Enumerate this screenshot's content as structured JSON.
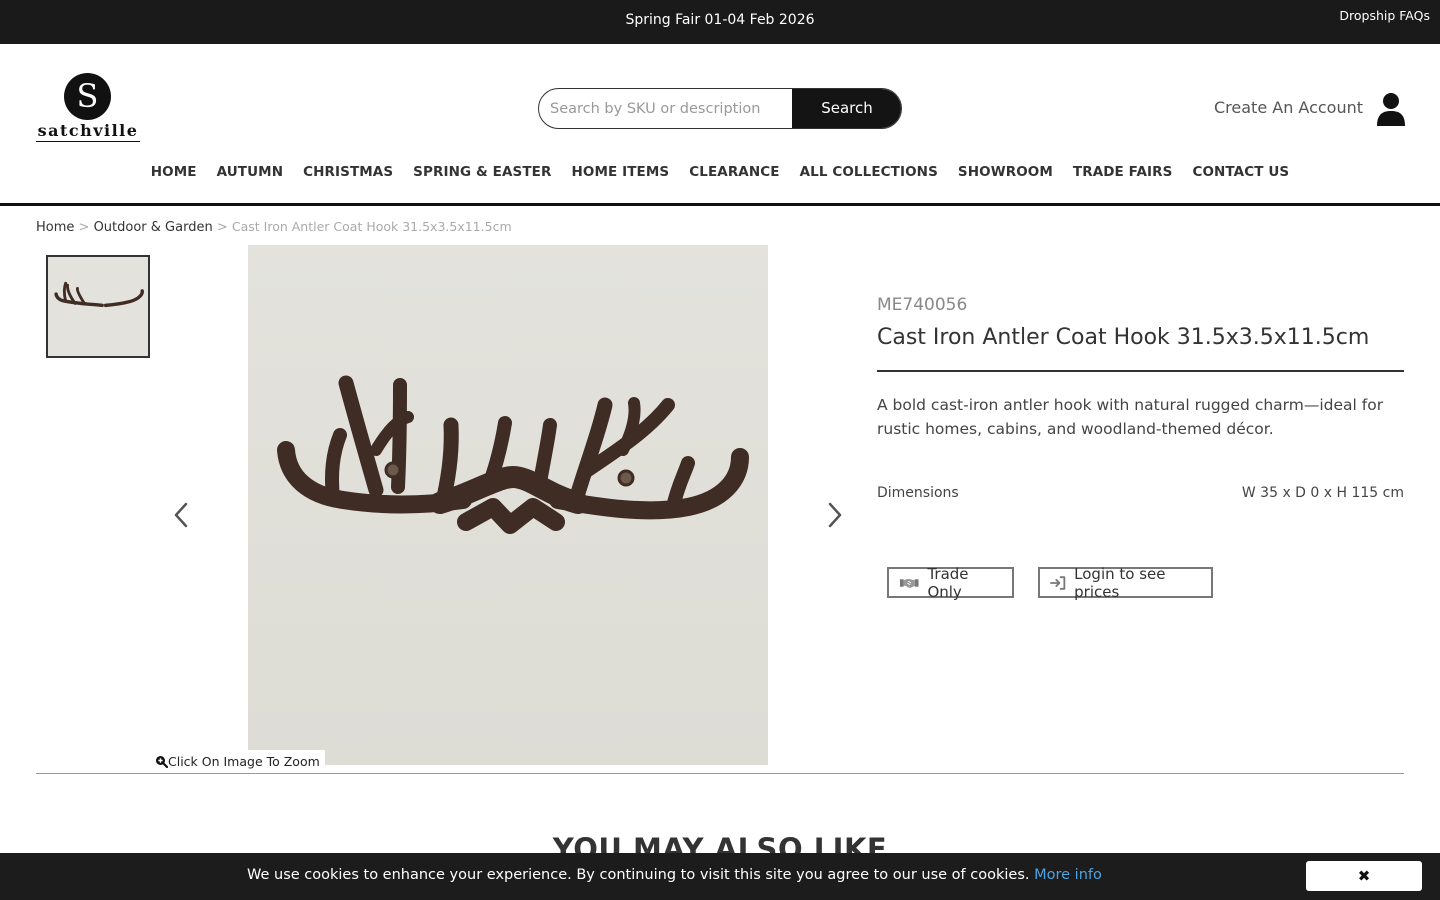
{
  "topbar": {
    "announcement": "Spring Fair 01-04 Feb 2026",
    "dropship_link": "Dropship FAQs"
  },
  "header": {
    "logo_letter": "S",
    "logo_word": "satchville",
    "search_placeholder": "Search by SKU or description",
    "search_button": "Search",
    "create_account": "Create An Account",
    "user_icon": "user-icon"
  },
  "nav": {
    "items": [
      "HOME",
      "AUTUMN",
      "CHRISTMAS",
      "SPRING & EASTER",
      "HOME ITEMS",
      "CLEARANCE",
      "ALL COLLECTIONS",
      "SHOWROOM",
      "TRADE FAIRS",
      "CONTACT US"
    ]
  },
  "breadcrumb": {
    "home": "Home",
    "separator": ">",
    "category": "Outdoor & Garden",
    "current": "Cast Iron Antler Coat Hook 31.5x3.5x11.5cm"
  },
  "gallery": {
    "zoom_note": "Click On Image To Zoom",
    "prev_icon": "chevron-left-icon",
    "next_icon": "chevron-right-icon"
  },
  "product": {
    "sku": "ME740056",
    "title": "Cast Iron Antler Coat Hook 31.5x3.5x11.5cm",
    "description": "A bold cast-iron antler hook with natural rugged charm—ideal for rustic homes, cabins, and woodland-themed décor.",
    "dimensions_label": "Dimensions",
    "dimensions_value": "W 35 x D 0 x H 115 cm",
    "trade_only": "Trade Only",
    "login_prices": "Login to see prices"
  },
  "related": {
    "heading": "YOU MAY ALSO LIKE"
  },
  "cookie": {
    "message": "We use cookies to enhance your experience. By continuing to visit this site you agree to our use of cookies.",
    "more_info": "More info",
    "close_symbol": "✖"
  },
  "colors": {
    "topbar_bg": "#1a1a1a",
    "cookie_bg": "#1c1c1c",
    "link_blue": "#4aa3df",
    "image_bg": "#e3e2dc"
  }
}
